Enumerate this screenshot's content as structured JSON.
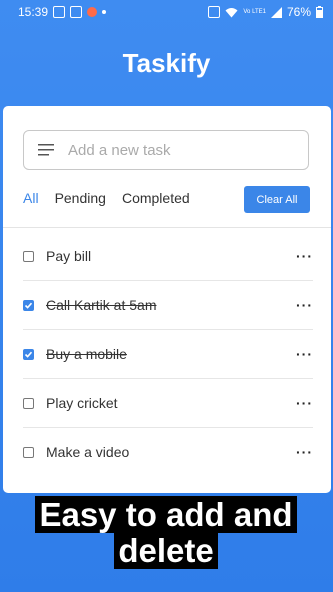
{
  "status": {
    "time": "15:39",
    "battery": "76%",
    "network": "Vo LTE1"
  },
  "app": {
    "title": "Taskify"
  },
  "search": {
    "placeholder": "Add a new task"
  },
  "filters": {
    "all": "All",
    "pending": "Pending",
    "completed": "Completed",
    "clear_label": "Clear All",
    "active": "All"
  },
  "colors": {
    "accent": "#3b86e8",
    "background": "#3f8cf1"
  },
  "tasks": [
    {
      "label": "Pay bill",
      "done": false,
      "menu": "···"
    },
    {
      "label": "Call Kartik at 5am",
      "done": true,
      "menu": "···"
    },
    {
      "label": "Buy a mobile",
      "done": true,
      "menu": "···"
    },
    {
      "label": "Play cricket",
      "done": false,
      "menu": "···"
    },
    {
      "label": "Make a video",
      "done": false,
      "menu": "···"
    }
  ],
  "caption": {
    "line1": "Easy to add and",
    "line2": "delete"
  }
}
